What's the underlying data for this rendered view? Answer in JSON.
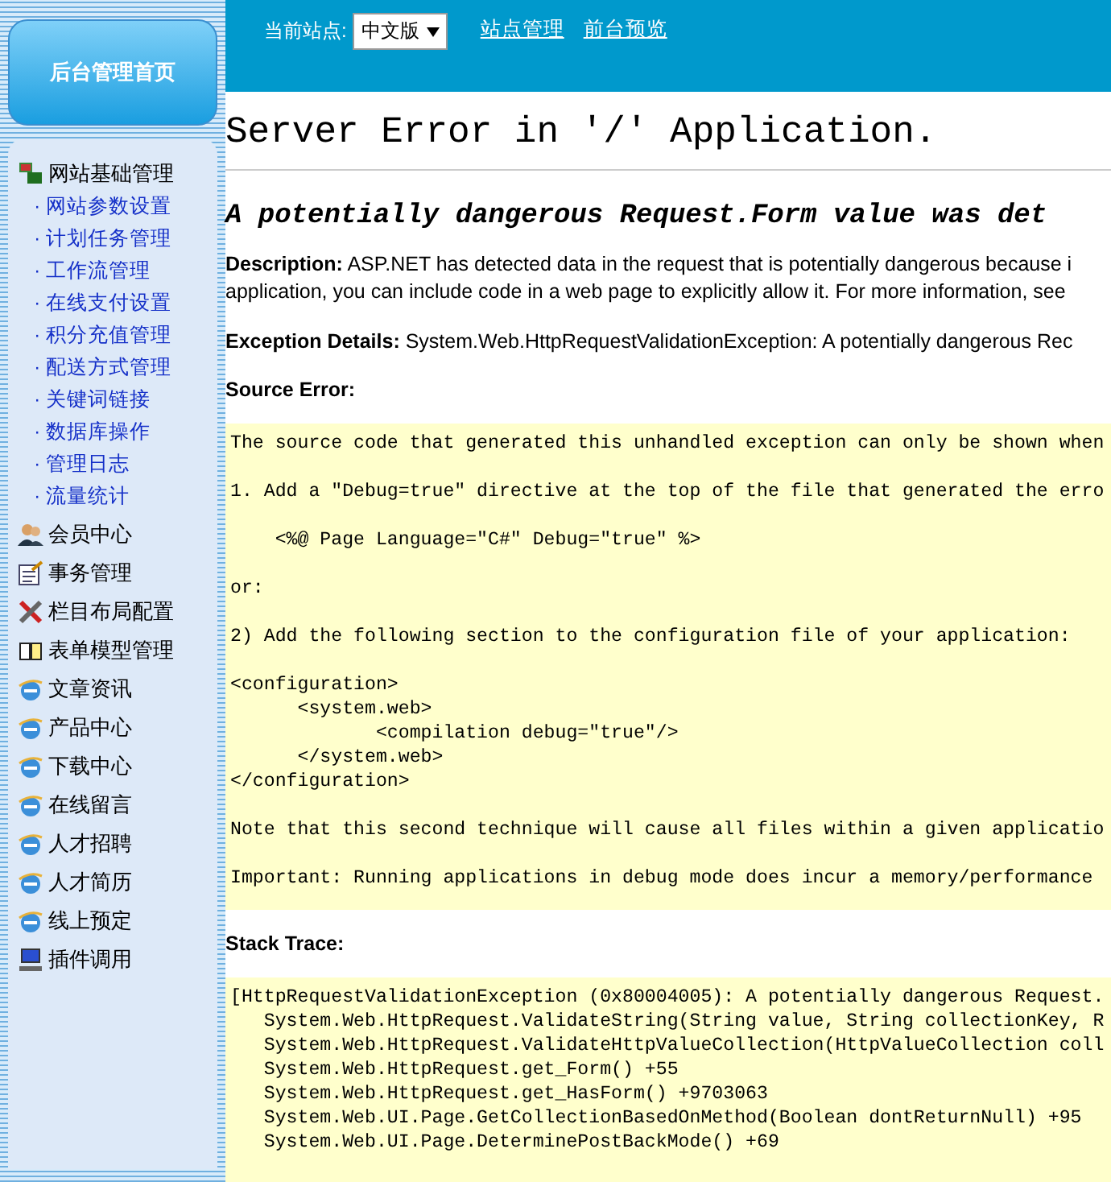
{
  "header": {
    "site_label": "当前站点:",
    "site_select": {
      "value": "中文版"
    },
    "links": [
      "站点管理",
      "前台预览"
    ]
  },
  "sidebar": {
    "home_button": "后台管理首页",
    "items": [
      {
        "label": "网站基础管理",
        "kind": "network",
        "children": [
          "· 网站参数设置",
          "· 计划任务管理",
          "· 工作流管理",
          "· 在线支付设置",
          "· 积分充值管理",
          "· 配送方式管理",
          "· 关键词链接",
          "· 数据库操作",
          "· 管理日志",
          "· 流量统计"
        ]
      },
      {
        "label": "会员中心",
        "kind": "users"
      },
      {
        "label": "事务管理",
        "kind": "form"
      },
      {
        "label": "栏目布局配置",
        "kind": "tools"
      },
      {
        "label": "表单模型管理",
        "kind": "book"
      },
      {
        "label": "文章资讯",
        "kind": "browser"
      },
      {
        "label": "产品中心",
        "kind": "browser"
      },
      {
        "label": "下载中心",
        "kind": "browser"
      },
      {
        "label": "在线留言",
        "kind": "browser"
      },
      {
        "label": "人才招聘",
        "kind": "browser"
      },
      {
        "label": "人才简历",
        "kind": "browser"
      },
      {
        "label": "线上预定",
        "kind": "browser"
      },
      {
        "label": "插件调用",
        "kind": "computer"
      }
    ]
  },
  "error_page": {
    "title": "Server Error in '/' Application.",
    "subtitle": "A potentially dangerous Request.Form value was det",
    "description": "**Description:** ASP.NET has detected data in the request that is potentially dangerous because i\napplication, you can include code in a web page to explicitly allow it. For more information, see",
    "exception_details": "**Exception Details:** System.Web.HttpRequestValidationException: A potentially dangerous Rec",
    "source_error_heading": "Source Error:",
    "source_code": [
      [
        "The source code that generated this unhandled exception can only be shown when"
      ],
      [
        "1. Add a \"Debug=true\" directive at the top of the file that generated the erro"
      ],
      [
        "    <%@ Page Language=\"C#\" Debug=\"true\" %>"
      ],
      [
        "or:"
      ],
      [
        "2) Add the following section to the configuration file of your application:"
      ],
      [
        "<configuration>",
        "      <system.web>",
        "             <compilation debug=\"true\"/>",
        "      </system.web>",
        "</configuration>"
      ],
      [
        "Note that this second technique will cause all files within a given applicatio"
      ],
      [
        "Important: Running applications in debug mode does incur a memory/performance"
      ]
    ],
    "stack_trace_heading": "Stack Trace:",
    "stack_trace": [
      "[HttpRequestValidationException (0x80004005): A potentially dangerous Request.",
      "   System.Web.HttpRequest.ValidateString(String value, String collectionKey, R",
      "   System.Web.HttpRequest.ValidateHttpValueCollection(HttpValueCollection coll",
      "   System.Web.HttpRequest.get_Form() +55",
      "   System.Web.HttpRequest.get_HasForm() +9703063",
      "   System.Web.UI.Page.GetCollectionBasedOnMethod(Boolean dontReturnNull) +95",
      "   System.Web.UI.Page.DeterminePostBackMode() +69"
    ]
  }
}
